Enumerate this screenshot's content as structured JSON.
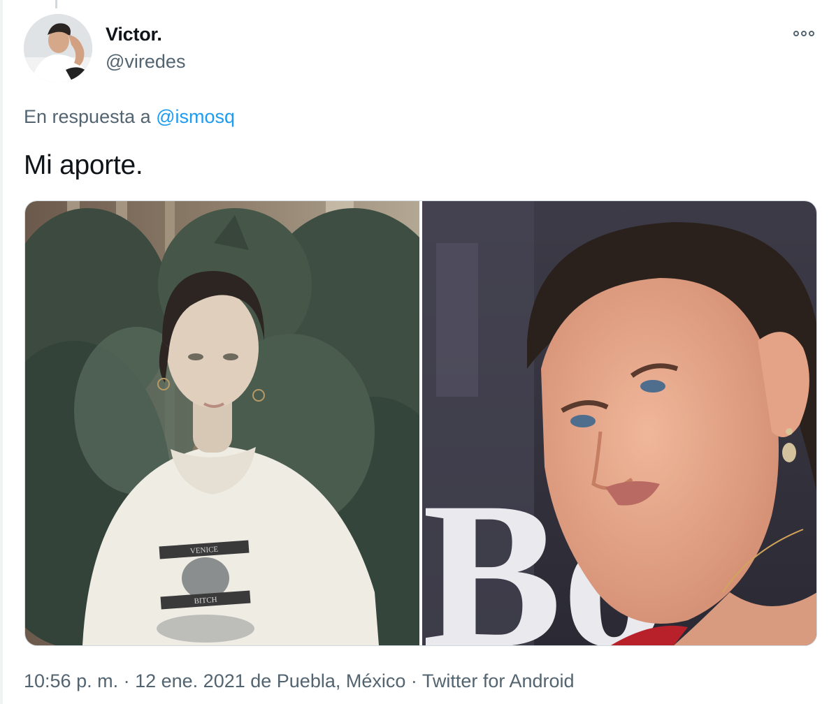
{
  "tweet": {
    "author": {
      "display_name": "Victor.",
      "handle": "@viredes"
    },
    "reply_prefix": "En respuesta a",
    "reply_to": "@ismosq",
    "text": "Mi aporte.",
    "shirt_text_top": "VENICE",
    "shirt_text_bottom": "BITCH",
    "background_sign_letters": "Bo",
    "timestamp": {
      "time": "10:56 p. m.",
      "separator1": " · ",
      "date": "12 ene. 2021",
      "location": " de Puebla, México",
      "separator2": " · ",
      "source": "Twitter for Android"
    }
  },
  "icons": {
    "more": "more-options-icon"
  },
  "colors": {
    "text_primary": "#0f1419",
    "text_secondary": "#536471",
    "link": "#1d9bf0",
    "border": "#cfd9de"
  }
}
